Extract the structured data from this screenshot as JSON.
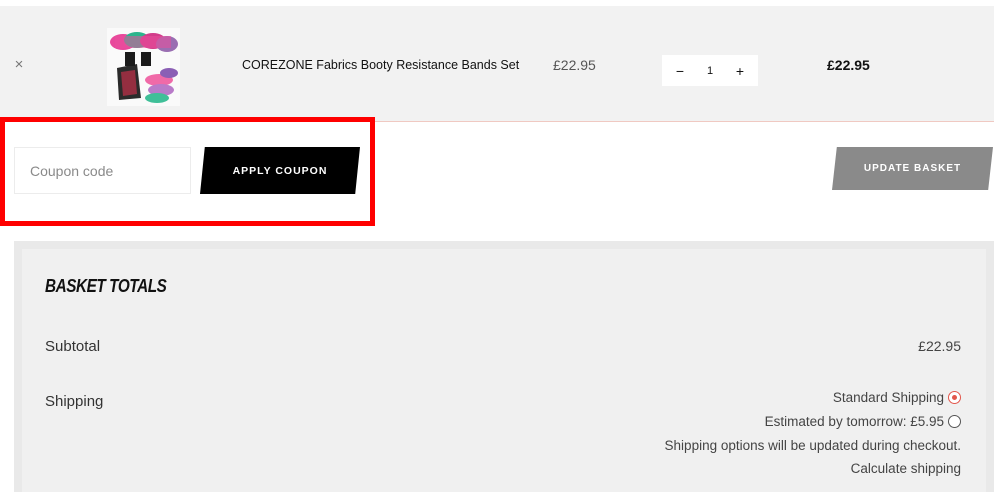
{
  "cart": {
    "items": [
      {
        "name": "COREZONE Fabrics Booty Resistance Bands Set",
        "unit_price": "£22.95",
        "quantity": "1",
        "line_total": "£22.95",
        "remove_symbol": "×",
        "qty_minus": "−",
        "qty_plus": "+"
      }
    ]
  },
  "coupon": {
    "placeholder": "Coupon code",
    "apply_label": "APPLY COUPON",
    "update_label": "UPDATE BASKET"
  },
  "totals": {
    "title": "BASKET TOTALS",
    "subtotal_label": "Subtotal",
    "subtotal_value": "£22.95",
    "shipping_label": "Shipping",
    "shipping_options": [
      {
        "label": "Standard Shipping",
        "selected": true
      },
      {
        "label": "Estimated by tomorrow: £5.95",
        "selected": false
      }
    ],
    "shipping_note": "Shipping options will be updated during checkout.",
    "calculate_label": "Calculate shipping"
  },
  "colors": {
    "accent": "#e2574c",
    "highlight": "#ff0000",
    "button_dark": "#000000",
    "button_disabled": "#8a8a8a"
  }
}
